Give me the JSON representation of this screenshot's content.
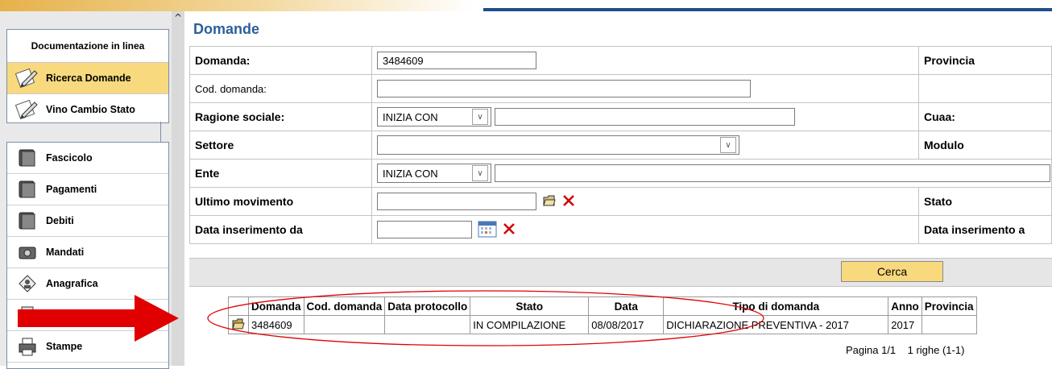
{
  "sidebar": {
    "section1": {
      "title": "Documentazione in linea",
      "items": [
        {
          "label": "Ricerca Domande",
          "icon": "pencil-icon",
          "active": true
        },
        {
          "label": "Vino Cambio Stato",
          "icon": "pencil-icon",
          "active": false
        }
      ]
    },
    "section2": {
      "items": [
        {
          "label": "Fascicolo",
          "icon": "binder-icon"
        },
        {
          "label": "Pagamenti",
          "icon": "binder-icon"
        },
        {
          "label": "Debiti",
          "icon": "binder-icon"
        },
        {
          "label": "Mandati",
          "icon": "camera-icon"
        },
        {
          "label": "Anagrafica",
          "icon": "person-card-icon"
        },
        {
          "label": "",
          "icon": "document-icon"
        },
        {
          "label": "Stampe",
          "icon": "printer-icon"
        }
      ]
    },
    "scroll_up": "^"
  },
  "main": {
    "title": "Domande",
    "form": {
      "domanda": {
        "label": "Domanda:",
        "value": "3484609"
      },
      "provincia_label": "Provincia",
      "cod_domanda": {
        "label": "Cod. domanda:",
        "value": ""
      },
      "ragione_sociale": {
        "label": "Ragione sociale:",
        "operator": "INIZIA CON",
        "value": ""
      },
      "cuaa_label": "Cuaa:",
      "settore": {
        "label": "Settore",
        "value": ""
      },
      "modulo_label": "Modulo",
      "ente": {
        "label": "Ente",
        "operator": "INIZIA CON",
        "value": ""
      },
      "ultimo_movimento": {
        "label": "Ultimo movimento",
        "value": ""
      },
      "stato_label": "Stato",
      "data_inserimento_da": {
        "label": "Data inserimento da",
        "value": ""
      },
      "data_inserimento_a_label": "Data inserimento a"
    },
    "search_button": "Cerca",
    "results": {
      "headers": [
        "",
        "Domanda",
        "Cod. domanda",
        "Data protocollo",
        "Stato",
        "Data",
        "Tipo di domanda",
        "Anno",
        "Provincia"
      ],
      "rows": [
        {
          "domanda": "3484609",
          "cod_domanda": "",
          "data_protocollo": "",
          "stato": "IN COMPILAZIONE",
          "data": "08/08/2017",
          "tipo": "DICHIARAZIONE PREVENTIVA - 2017",
          "anno": "2017",
          "provincia": ""
        }
      ],
      "pager": "Pagina 1/1    1 righe (1-1)"
    }
  },
  "colors": {
    "title_blue": "#2d5f9a",
    "active_yellow": "#f8d97d",
    "annotation_red": "#e00000"
  }
}
